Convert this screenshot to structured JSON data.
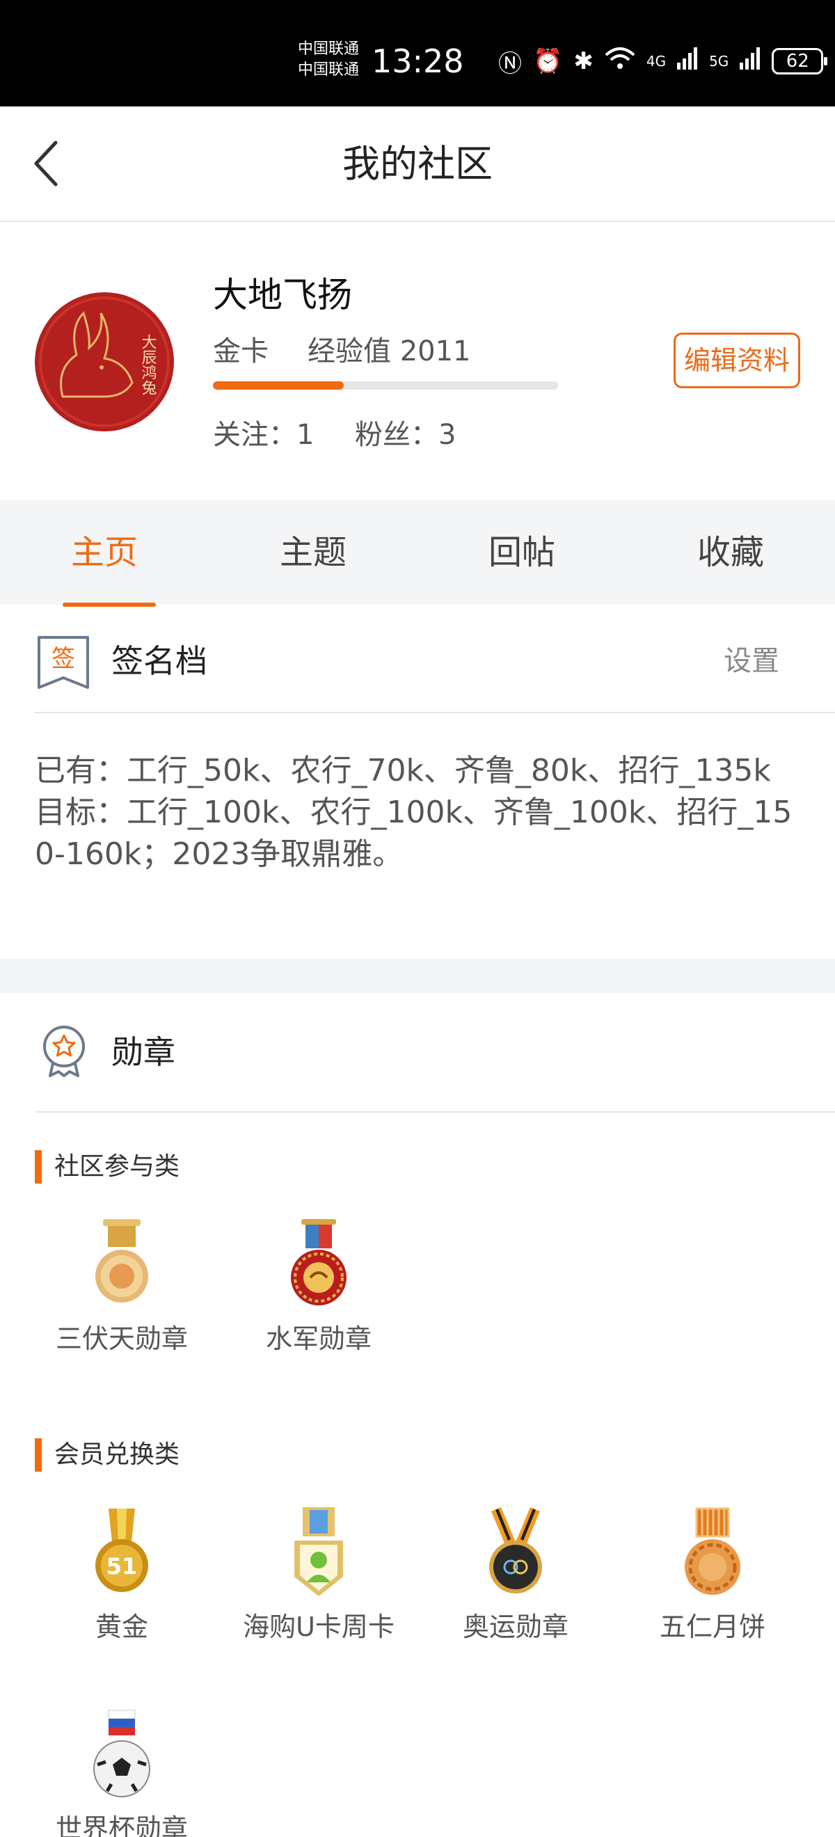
{
  "status_bar": {
    "carrier_1": "中国联通",
    "carrier_2": "中国联通",
    "time": "13:28",
    "network_1": "4G",
    "network_2": "5G",
    "battery": "62"
  },
  "header": {
    "title": "我的社区"
  },
  "profile": {
    "name": "大地飞扬",
    "level": "金卡",
    "experience_label": "经验值 2011",
    "experience_progress": 0.38,
    "follow_label": "关注：1",
    "fans_label": "粉丝：3",
    "avatar_text": "大辰鸿兔",
    "edit_label": "编辑资料"
  },
  "tabs": [
    {
      "label": "主页",
      "active": true
    },
    {
      "label": "主题",
      "active": false
    },
    {
      "label": "回帖",
      "active": false
    },
    {
      "label": "收藏",
      "active": false
    }
  ],
  "signature": {
    "icon_char": "签",
    "title": "签名档",
    "setting_label": "设置",
    "content": "已有：工行_50k、农行_70k、齐鲁_80k、招行_135k\n目标：工行_100k、农行_100k、齐鲁_100k、招行_150-160k；2023争取鼎雅。"
  },
  "medals": {
    "title": "勋章",
    "groups": [
      {
        "category": "社区参与类",
        "items": [
          {
            "label": "三伏天勋章"
          },
          {
            "label": "水军勋章"
          }
        ]
      },
      {
        "category": "会员兑换类",
        "items": [
          {
            "label": "黄金",
            "number": "51"
          },
          {
            "label": "海购U卡周卡"
          },
          {
            "label": "奥运勋章"
          },
          {
            "label": "五仁月饼"
          },
          {
            "label": "世界杯勋章"
          }
        ]
      }
    ]
  },
  "colors": {
    "accent": "#f26a10",
    "status_bar": "#000000",
    "tab_bg": "#f4f5f7"
  }
}
